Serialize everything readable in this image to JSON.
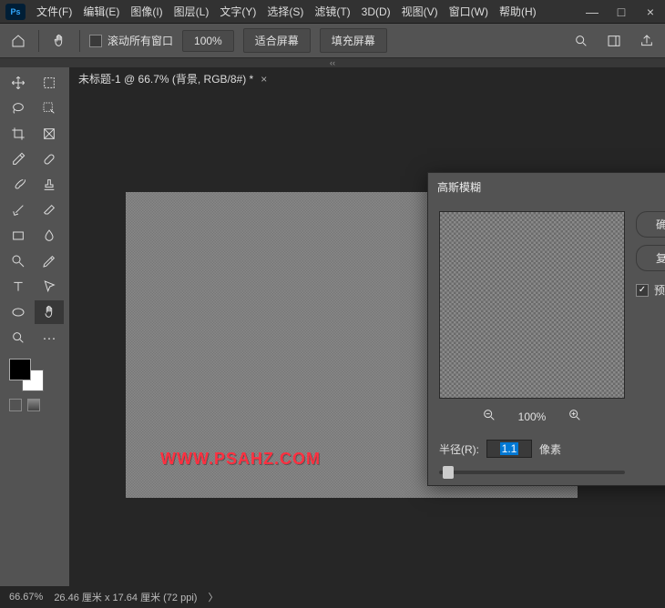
{
  "menu": [
    "文件(F)",
    "编辑(E)",
    "图像(I)",
    "图层(L)",
    "文字(Y)",
    "选择(S)",
    "滤镜(T)",
    "3D(D)",
    "视图(V)",
    "窗口(W)",
    "帮助(H)"
  ],
  "optbar": {
    "scroll_all": "滚动所有窗口",
    "zoom": "100%",
    "fit": "适合屏幕",
    "fill": "填充屏幕"
  },
  "tab": {
    "title": "未标题-1 @ 66.7% (背景, RGB/8#) *",
    "close": "×"
  },
  "dialog": {
    "title": "高斯模糊",
    "ok": "确定",
    "reset": "复位",
    "preview": "预览(P)",
    "zoom": "100%",
    "radius_label": "半径(R):",
    "radius_value": "1.1",
    "radius_unit": "像素"
  },
  "watermark": "WWW.PSAHZ.COM",
  "status": {
    "zoom": "66.67%",
    "dims": "26.46 厘米 x 17.64 厘米 (72 ppi)"
  }
}
